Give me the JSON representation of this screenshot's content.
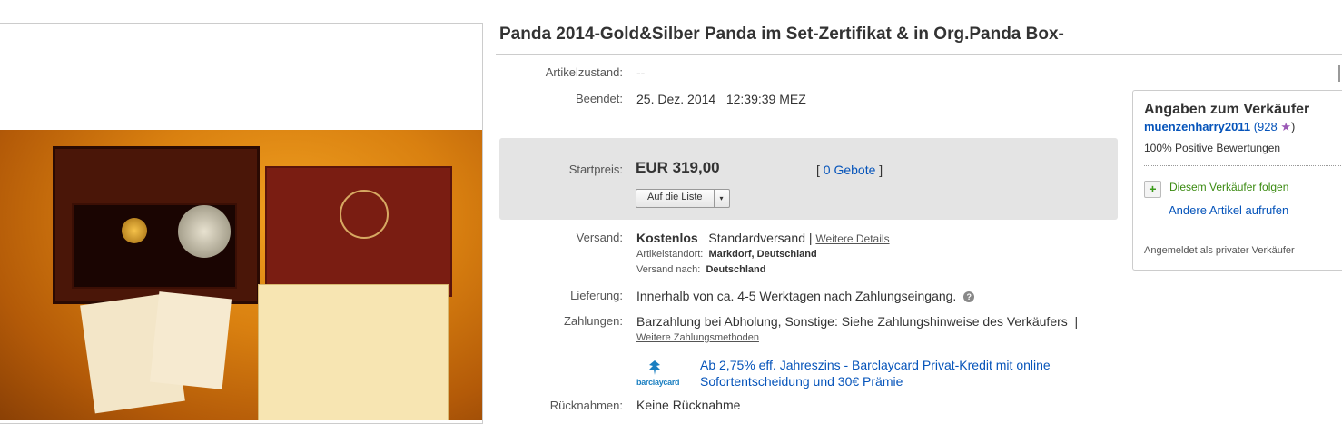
{
  "title": "Panda 2014-Gold&Silber Panda im Set-Zertifikat & in Org.Panda Box-",
  "details": {
    "condition_label": "Artikelzustand:",
    "condition_value": "--",
    "ended_label": "Beendet:",
    "ended_date": "25. Dez. 2014",
    "ended_time": "12:39:39 MEZ"
  },
  "price": {
    "label": "Startpreis:",
    "value": "EUR 319,00",
    "bids_open": "[",
    "bids_link": "0 Gebote",
    "bids_close": "]",
    "watch_button": "Auf die Liste",
    "watch_arrow": "▾"
  },
  "shipping": {
    "label": "Versand:",
    "cost": "Kostenlos",
    "method": "Standardversand",
    "separator": "|",
    "details_link": "Weitere Details",
    "location_label": "Artikelstandort:",
    "location_value": "Markdorf, Deutschland",
    "ships_to_label": "Versand nach:",
    "ships_to_value": "Deutschland"
  },
  "delivery": {
    "label": "Lieferung:",
    "value": "Innerhalb von ca. 4-5 Werktagen nach Zahlungseingang.",
    "help_icon": "?"
  },
  "payments": {
    "label": "Zahlungen:",
    "value": "Barzahlung bei Abholung,  Sonstige: Siehe Zahlungshinweise des Verkäufers",
    "separator": "|",
    "more_link": "Weitere Zahlungsmethoden",
    "barclay_logo_text": "barclaycard",
    "barclay_line1": "Ab 2,75% eff. Jahreszins - Barclaycard Privat-Kredit mit online",
    "barclay_line2": "Sofortentscheidung und 30€ Prämie"
  },
  "returns": {
    "label": "Rücknahmen:",
    "value": "Keine Rücknahme"
  },
  "seller": {
    "heading": "Angaben zum Verkäufer",
    "name": "muenzenharry2011",
    "score_open": "(928",
    "score_close": ")",
    "star": "★",
    "positive": "100% Positive Bewertungen",
    "follow_icon": "+",
    "follow": "Diesem Verkäufer folgen",
    "other_items": "Andere Artikel aufrufen",
    "private": "Angemeldet als privater Verkäufer"
  },
  "colors": {
    "link": "#0654ba",
    "follow_green": "#3a8a10",
    "star_purple": "#9b59b6",
    "price_box": "#e4e4e4"
  }
}
